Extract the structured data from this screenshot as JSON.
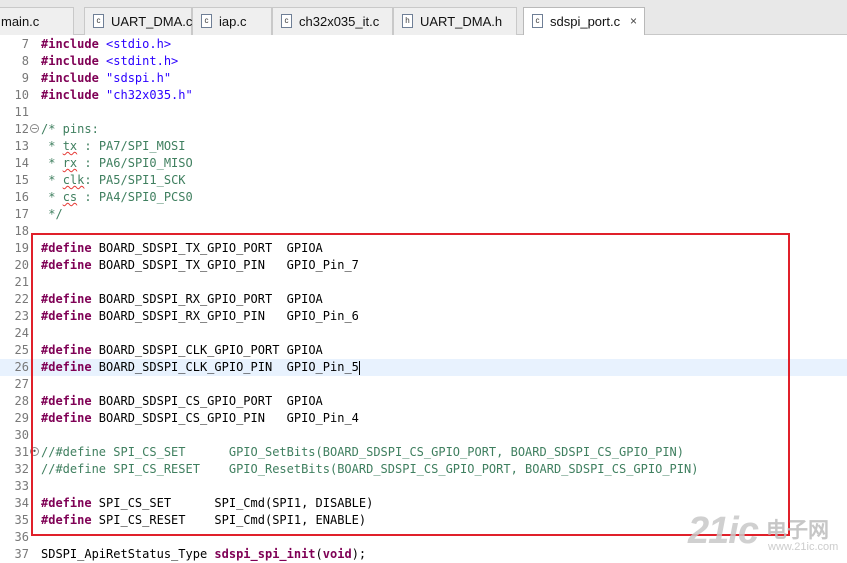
{
  "tabs": [
    {
      "label": "main.c",
      "icon": "c-file-icon",
      "active": false
    },
    {
      "label": "UART_DMA.c",
      "icon": "c-file-icon",
      "active": false
    },
    {
      "label": "iap.c",
      "icon": "c-file-icon",
      "active": false
    },
    {
      "label": "ch32x035_it.c",
      "icon": "c-file-icon",
      "active": false
    },
    {
      "label": "UART_DMA.h",
      "icon": "h-file-icon",
      "active": false
    },
    {
      "label": "sdspi_port.c",
      "icon": "c-file-icon",
      "active": true,
      "close": "×"
    }
  ],
  "editor": {
    "current_line": 26,
    "lines": [
      {
        "n": "7",
        "fold": "",
        "tokens": [
          {
            "t": "#include",
            "c": "kw"
          },
          {
            "t": " ",
            "c": ""
          },
          {
            "t": "<stdio.h>",
            "c": "str"
          }
        ]
      },
      {
        "n": "8",
        "fold": "",
        "tokens": [
          {
            "t": "#include",
            "c": "kw"
          },
          {
            "t": " ",
            "c": ""
          },
          {
            "t": "<stdint.h>",
            "c": "str"
          }
        ]
      },
      {
        "n": "9",
        "fold": "",
        "tokens": [
          {
            "t": "#include",
            "c": "kw"
          },
          {
            "t": " ",
            "c": ""
          },
          {
            "t": "\"sdspi.h\"",
            "c": "str"
          }
        ]
      },
      {
        "n": "10",
        "fold": "",
        "tokens": [
          {
            "t": "#include",
            "c": "kw"
          },
          {
            "t": " ",
            "c": ""
          },
          {
            "t": "\"ch32x035.h\"",
            "c": "str"
          }
        ]
      },
      {
        "n": "11",
        "fold": "",
        "tokens": []
      },
      {
        "n": "12",
        "fold": "−",
        "tokens": [
          {
            "t": "/* pins:",
            "c": "cm"
          }
        ]
      },
      {
        "n": "13",
        "fold": "",
        "tokens": [
          {
            "t": " * ",
            "c": "cm"
          },
          {
            "t": "tx",
            "c": "cm sq"
          },
          {
            "t": " : PA7/SPI_MOSI",
            "c": "cm"
          }
        ]
      },
      {
        "n": "14",
        "fold": "",
        "tokens": [
          {
            "t": " * ",
            "c": "cm"
          },
          {
            "t": "rx",
            "c": "cm sq"
          },
          {
            "t": " : PA6/SPI0_MISO",
            "c": "cm"
          }
        ]
      },
      {
        "n": "15",
        "fold": "",
        "tokens": [
          {
            "t": " * ",
            "c": "cm"
          },
          {
            "t": "clk",
            "c": "cm sq"
          },
          {
            "t": ": PA5/SPI1_SCK",
            "c": "cm"
          }
        ]
      },
      {
        "n": "16",
        "fold": "",
        "tokens": [
          {
            "t": " * ",
            "c": "cm"
          },
          {
            "t": "cs",
            "c": "cm sq"
          },
          {
            "t": " : PA4/SPI0_PCS0",
            "c": "cm"
          }
        ]
      },
      {
        "n": "17",
        "fold": "",
        "tokens": [
          {
            "t": " */",
            "c": "cm"
          }
        ]
      },
      {
        "n": "18",
        "fold": "",
        "tokens": []
      },
      {
        "n": "19",
        "fold": "",
        "tokens": [
          {
            "t": "#define",
            "c": "kw"
          },
          {
            "t": " BOARD_SDSPI_TX_GPIO_PORT  GPIOA",
            "c": ""
          }
        ]
      },
      {
        "n": "20",
        "fold": "",
        "tokens": [
          {
            "t": "#define",
            "c": "kw"
          },
          {
            "t": " BOARD_SDSPI_TX_GPIO_PIN   GPIO_Pin_7",
            "c": ""
          }
        ]
      },
      {
        "n": "21",
        "fold": "",
        "tokens": []
      },
      {
        "n": "22",
        "fold": "",
        "tokens": [
          {
            "t": "#define",
            "c": "kw"
          },
          {
            "t": " BOARD_SDSPI_RX_GPIO_PORT  GPIOA",
            "c": ""
          }
        ]
      },
      {
        "n": "23",
        "fold": "",
        "tokens": [
          {
            "t": "#define",
            "c": "kw"
          },
          {
            "t": " BOARD_SDSPI_RX_GPIO_PIN   GPIO_Pin_6",
            "c": ""
          }
        ]
      },
      {
        "n": "24",
        "fold": "",
        "tokens": []
      },
      {
        "n": "25",
        "fold": "",
        "tokens": [
          {
            "t": "#define",
            "c": "kw"
          },
          {
            "t": " BOARD_SDSPI_CLK_GPIO_PORT GPIOA",
            "c": ""
          }
        ]
      },
      {
        "n": "26",
        "fold": "",
        "tokens": [
          {
            "t": "#define",
            "c": "kw"
          },
          {
            "t": " BOARD_SDSPI_CLK_GPIO_PIN  GPIO_Pin_5",
            "c": ""
          }
        ]
      },
      {
        "n": "27",
        "fold": "",
        "tokens": []
      },
      {
        "n": "28",
        "fold": "",
        "tokens": [
          {
            "t": "#define",
            "c": "kw"
          },
          {
            "t": " BOARD_SDSPI_CS_GPIO_PORT  GPIOA",
            "c": ""
          }
        ]
      },
      {
        "n": "29",
        "fold": "",
        "tokens": [
          {
            "t": "#define",
            "c": "kw"
          },
          {
            "t": " BOARD_SDSPI_CS_GPIO_PIN   GPIO_Pin_4",
            "c": ""
          }
        ]
      },
      {
        "n": "30",
        "fold": "",
        "tokens": []
      },
      {
        "n": "31",
        "fold": "•",
        "tokens": [
          {
            "t": "//#define SPI_CS_SET      GPIO_SetBits(BOARD_SDSPI_CS_GPIO_PORT, BOARD_SDSPI_CS_GPIO_PIN)",
            "c": "cm"
          }
        ]
      },
      {
        "n": "32",
        "fold": "",
        "tokens": [
          {
            "t": "//#define SPI_CS_RESET    GPIO_ResetBits(BOARD_SDSPI_CS_GPIO_PORT, BOARD_SDSPI_CS_GPIO_PIN)",
            "c": "cm"
          }
        ]
      },
      {
        "n": "33",
        "fold": "",
        "tokens": []
      },
      {
        "n": "34",
        "fold": "",
        "tokens": [
          {
            "t": "#define",
            "c": "kw"
          },
          {
            "t": " SPI_CS_SET      SPI_Cmd(SPI1, DISABLE)",
            "c": ""
          }
        ]
      },
      {
        "n": "35",
        "fold": "",
        "tokens": [
          {
            "t": "#define",
            "c": "kw"
          },
          {
            "t": " SPI_CS_RESET    SPI_Cmd(SPI1, ENABLE)",
            "c": ""
          }
        ]
      },
      {
        "n": "36",
        "fold": "",
        "tokens": []
      },
      {
        "n": "37",
        "fold": "",
        "tokens": [
          {
            "t": "SDSPI_ApiRetStatus_Type ",
            "c": ""
          },
          {
            "t": "sdspi_spi_init",
            "c": "kw"
          },
          {
            "t": "(",
            "c": ""
          },
          {
            "t": "void",
            "c": "kw"
          },
          {
            "t": ");",
            "c": ""
          }
        ]
      }
    ]
  },
  "highlight": {
    "color": "#e0202a"
  },
  "watermark": {
    "main": "21ic",
    "cn": "电子网",
    "sub": "www.21ic.com"
  }
}
